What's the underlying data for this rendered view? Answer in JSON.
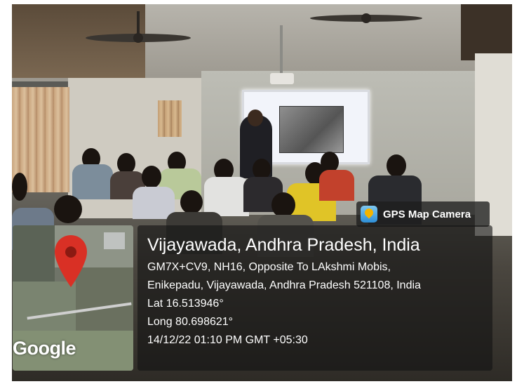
{
  "photo": {
    "scene": "classroom-presentation"
  },
  "overlay": {
    "badge_label": "GPS Map Camera",
    "map_logo": "Google",
    "location_title": "Vijayawada, Andhra Pradesh, India",
    "address_line1": "GM7X+CV9, NH16, Opposite To LAkshmi Mobis,",
    "address_line2": "Enikepadu, Vijayawada, Andhra Pradesh 521108, India",
    "lat": "Lat 16.513946°",
    "long": "Long 80.698621°",
    "timestamp": "14/12/22 01:10 PM GMT +05:30"
  },
  "icons": {
    "badge_icon": "gps-map-camera-icon",
    "map_pin": "map-pin-icon"
  },
  "colors": {
    "pin": "#d93025",
    "panel": "#141414"
  }
}
